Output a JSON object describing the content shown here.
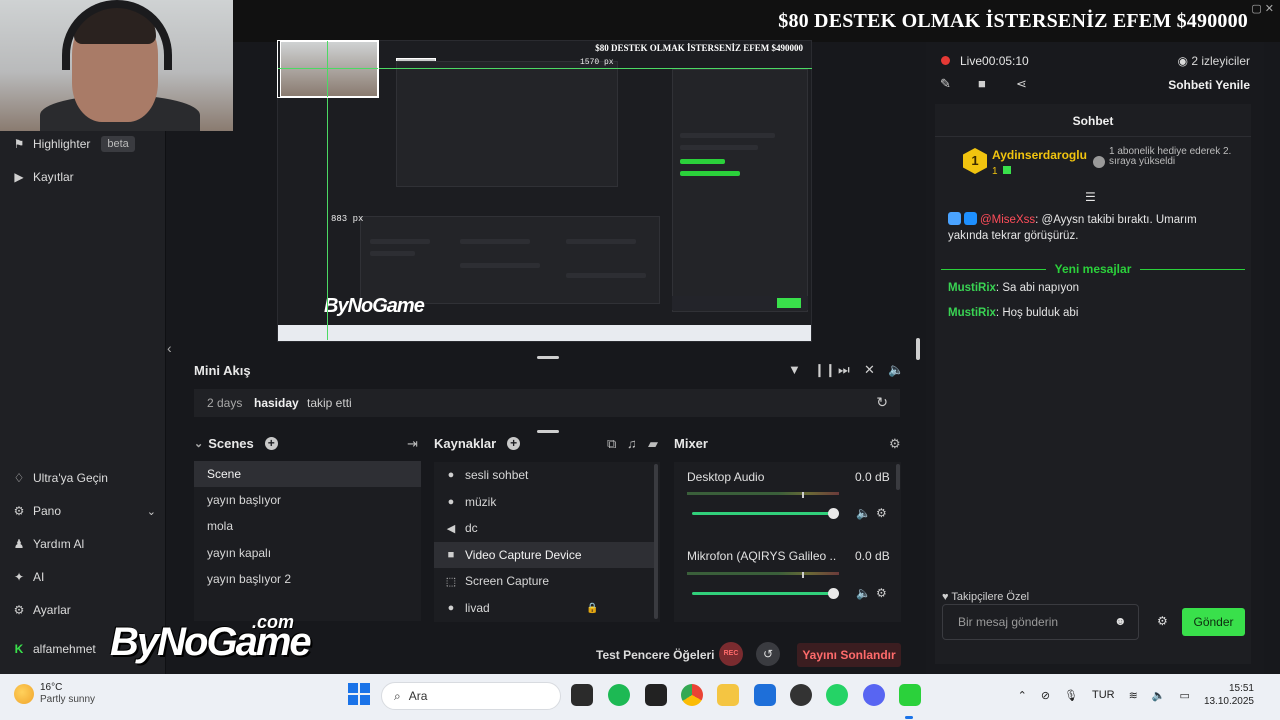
{
  "sidebar": {
    "items": [
      {
        "label": "Highlighter",
        "icon": "highlighter-icon",
        "badge": "beta"
      },
      {
        "label": "Kayıtlar",
        "icon": "recordings-icon"
      }
    ],
    "bottom_items": [
      {
        "label": "Ultra'ya Geçin",
        "icon": "ultra-icon"
      },
      {
        "label": "Pano",
        "icon": "dashboard-icon"
      },
      {
        "label": "Yardım Al",
        "icon": "help-icon"
      },
      {
        "label": "AI",
        "icon": "ai-sparkle-icon"
      },
      {
        "label": "Ayarlar",
        "icon": "gear-icon"
      },
      {
        "label": "alfamehmet",
        "icon": "kick-icon"
      }
    ]
  },
  "overlay": {
    "banner": "$80    DESTEK OLMAK İSTERSENİZ EFEM    $490000",
    "nested_banner": "$80    DESTEK OLMAK İSTERSENİZ EFEM    $490000",
    "nested_px_label": "883 px",
    "nested_px_label_top": "1570 px",
    "logo": "ByNoGame",
    "logo_suffix": ".com"
  },
  "mini_feed": {
    "title": "Mini Akış",
    "items": [
      {
        "ago": "2 days",
        "user": "hasiday",
        "action": "takip etti"
      }
    ]
  },
  "scenes": {
    "title": "Scenes",
    "items": [
      "Scene",
      "yayın başlıyor",
      "mola",
      "yayın kapalı",
      "yayın başlıyor 2"
    ],
    "selected_index": 0
  },
  "sources": {
    "title": "Kaynaklar",
    "items": [
      {
        "label": "sesli sohbet",
        "icon": "audio-dot-icon"
      },
      {
        "label": "müzik",
        "icon": "audio-dot-icon"
      },
      {
        "label": "dc",
        "icon": "speaker-icon"
      },
      {
        "label": "Video Capture Device",
        "icon": "camera-icon"
      },
      {
        "label": "Screen Capture",
        "icon": "screen-capture-icon"
      },
      {
        "label": "livad",
        "icon": "audio-dot-icon"
      }
    ],
    "selected_index": 3
  },
  "mixer": {
    "title": "Mixer",
    "channels": [
      {
        "name": "Desktop Audio",
        "db": "0.0 dB",
        "volume": 1.0
      },
      {
        "name": "Mikrofon (AQIRYS Galileo ...",
        "db": "0.0 dB",
        "volume": 1.0
      }
    ]
  },
  "controls": {
    "test_label": "Test Pencere Öğeleri",
    "rec_label": "REC",
    "end_label": "Yayını Sonlandır"
  },
  "stream": {
    "live_label": "Live",
    "elapsed": "00:05:10",
    "viewers": "2 izleyiciler",
    "refresh_chat": "Sohbeti Yenile"
  },
  "chat": {
    "title": "Sohbet",
    "top_supporter": {
      "name": "Aydinserdaroglu",
      "count": "1",
      "rank": "1"
    },
    "gift_text": "1 abonelik hediye ederek 2. sıraya yükseldi",
    "pinned": {
      "mention": "@MiseXss",
      "text": ": @Ayysn takibi bıraktı. Umarım yakında tekrar görüşürüz."
    },
    "new_messages_label": "Yeni mesajlar",
    "messages": [
      {
        "user": "MustiRix",
        "text": "Sa abi napıyon"
      },
      {
        "user": "MustiRix",
        "text": "Hoş bulduk abi"
      }
    ],
    "followers_only": "Takipçilere Özel",
    "input_placeholder": "Bir mesaj gönderin",
    "send_label": "Gönder"
  },
  "taskbar": {
    "weather_temp": "16°C",
    "weather_cond": "Partly sunny",
    "search_placeholder": "Ara",
    "language": "TUR",
    "time": "15:51",
    "date": "13.10.2025"
  },
  "colors": {
    "accent_green": "#39e04b",
    "live_red": "#e53935",
    "end_red": "#ff6b6b",
    "gold": "#f1c40f"
  }
}
